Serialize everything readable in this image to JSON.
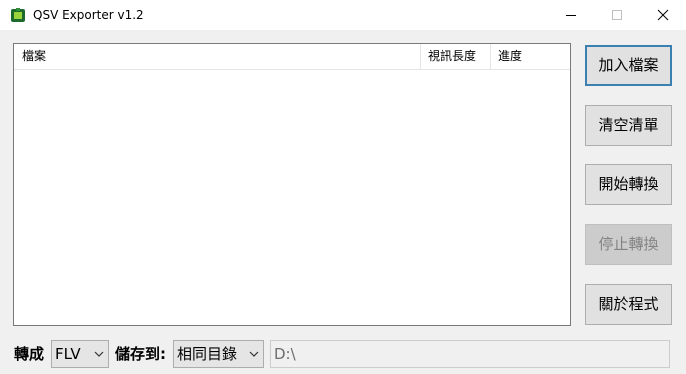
{
  "window": {
    "title": "QSV Exporter v1.2",
    "icon": "app-icon",
    "controls": [
      "minimize-icon",
      "maximize-icon",
      "close-icon"
    ]
  },
  "list": {
    "columns": [
      {
        "label": "檔案"
      },
      {
        "label": "視訊長度"
      },
      {
        "label": "進度"
      }
    ],
    "rows": []
  },
  "buttons": {
    "add_files": "加入檔案",
    "clear_list": "清空清單",
    "start_convert": "開始轉換",
    "stop_convert": "停止轉換",
    "about": "關於程式"
  },
  "bottom": {
    "convert_label": "轉成",
    "format_value": "FLV",
    "save_label": "儲存到:",
    "destination_value": "相同目錄",
    "path_value": "D:\\"
  },
  "colors": {
    "default_button_border": "#3c7fb1",
    "disabled_text": "#838383"
  }
}
